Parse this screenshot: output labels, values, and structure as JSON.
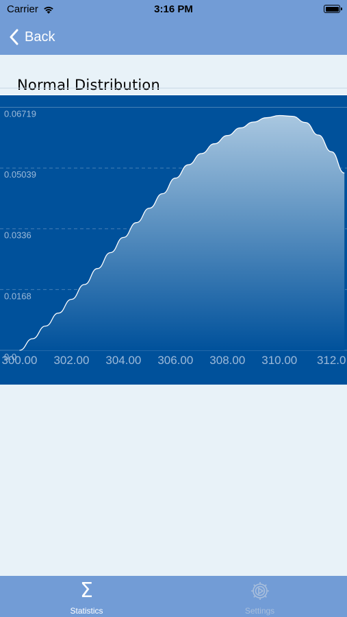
{
  "status_bar": {
    "carrier": "Carrier",
    "time": "3:16 PM"
  },
  "nav": {
    "back_label": "Back"
  },
  "chart_title": "Normal Distribution",
  "chart_data": {
    "type": "area",
    "title": "Normal Distribution",
    "xlabel": "",
    "ylabel": "",
    "x_ticks": [
      "300.00",
      "302.00",
      "304.00",
      "306.00",
      "308.00",
      "310.00",
      "312.0"
    ],
    "y_ticks": [
      "0.0",
      "0.0168",
      "0.0336",
      "0.05039",
      "0.06719"
    ],
    "x": [
      300.0,
      300.5,
      301.0,
      301.5,
      302.0,
      302.5,
      303.0,
      303.5,
      304.0,
      304.5,
      305.0,
      305.5,
      306.0,
      306.5,
      307.0,
      307.5,
      308.0,
      308.5,
      309.0,
      309.5,
      310.0,
      310.5,
      311.0,
      311.5,
      312.0,
      312.5
    ],
    "y": [
      0.0,
      0.0032,
      0.0067,
      0.0103,
      0.0141,
      0.0182,
      0.0226,
      0.027,
      0.0312,
      0.0353,
      0.0393,
      0.0433,
      0.0476,
      0.0513,
      0.0544,
      0.0571,
      0.0594,
      0.0615,
      0.0631,
      0.0643,
      0.0649,
      0.0647,
      0.063,
      0.0595,
      0.0549,
      0.049
    ],
    "xlim": [
      299.25,
      312.6
    ],
    "ylim": [
      0,
      0.0705
    ],
    "grid": true,
    "colors": {
      "background": "#00519b",
      "line": "#ffffff",
      "fill_top": "#a9c7e0",
      "fill_bottom": "#00519b"
    }
  },
  "tabs": [
    {
      "label": "Statistics",
      "icon": "sigma-icon",
      "active": true
    },
    {
      "label": "Settings",
      "icon": "gear-icon",
      "active": false
    }
  ]
}
